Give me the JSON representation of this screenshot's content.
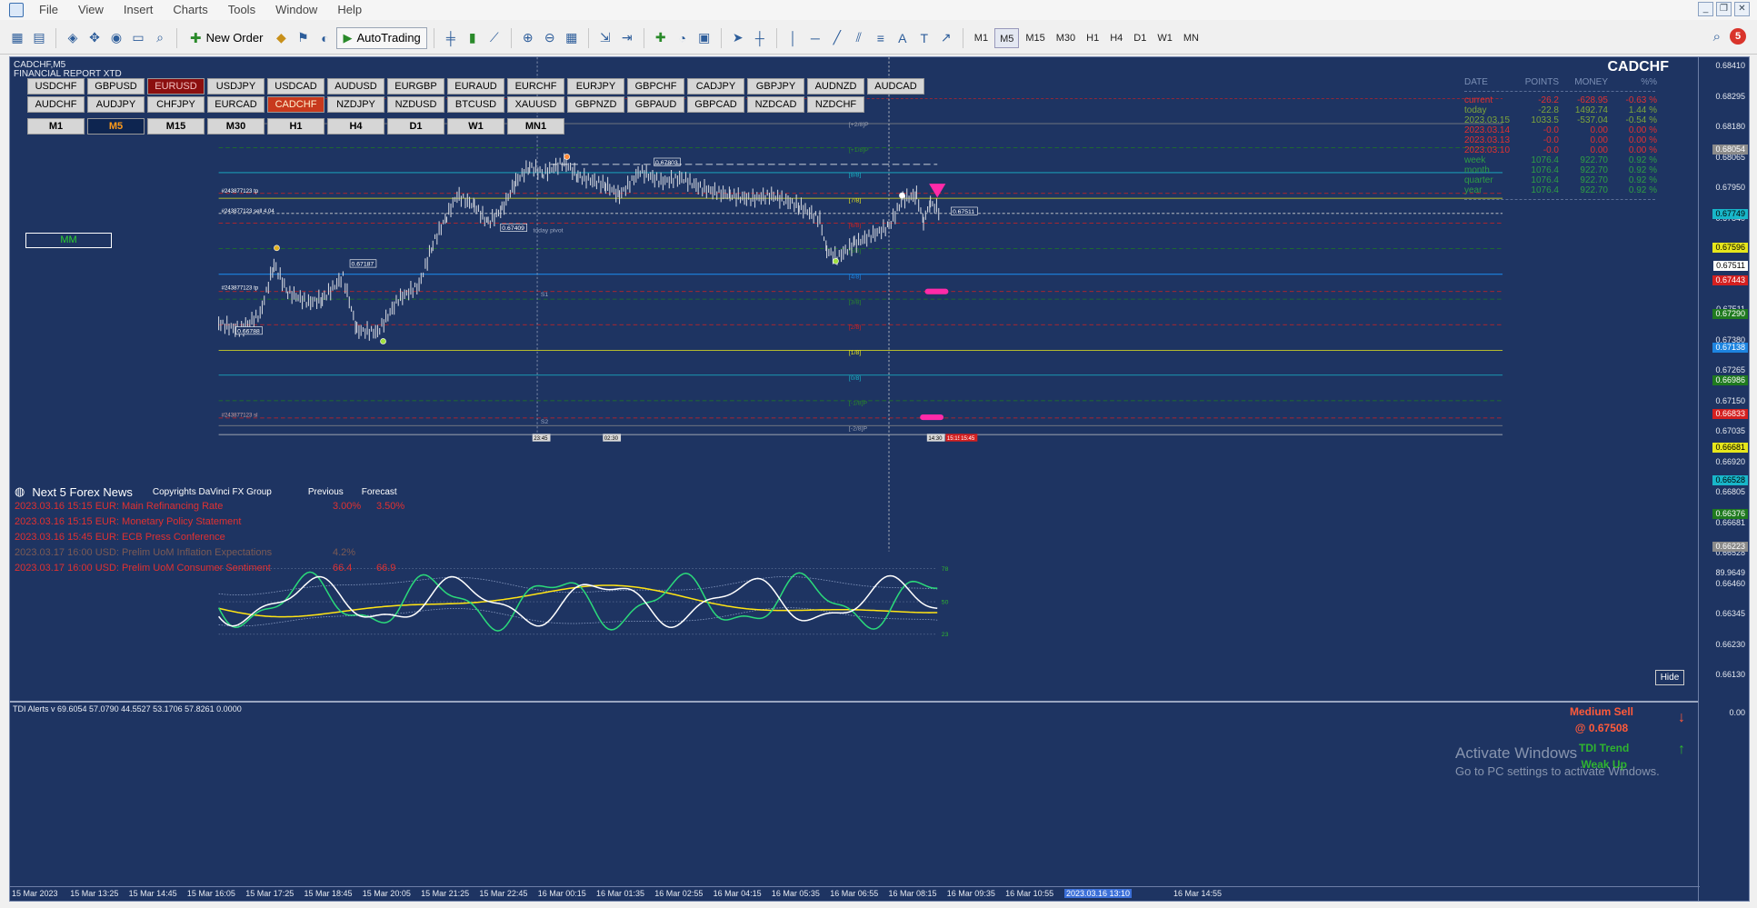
{
  "menu": [
    "File",
    "View",
    "Insert",
    "Charts",
    "Tools",
    "Window",
    "Help"
  ],
  "toolbar": {
    "new_order": "New Order",
    "autotrading": "AutoTrading",
    "timeframes": [
      "M1",
      "M5",
      "M15",
      "M30",
      "H1",
      "H4",
      "D1",
      "W1",
      "MN"
    ],
    "active_timeframe": "M5",
    "alert_count": "5"
  },
  "chart": {
    "title": "CADCHF,M5",
    "subtitle": "FINANCIAL REPORT XTD",
    "symbol_rows": [
      [
        "USDCHF",
        "GBPUSD",
        "EURUSD",
        "USDJPY",
        "USDCAD",
        "AUDUSD",
        "EURGBP",
        "EURAUD",
        "EURCHF",
        "EURJPY",
        "GBPCHF",
        "CADJPY",
        "GBPJPY",
        "AUDNZD",
        "AUDCAD"
      ],
      [
        "AUDCHF",
        "AUDJPY",
        "CHFJPY",
        "EURCAD",
        "CADCHF",
        "NZDJPY",
        "NZDUSD",
        "BTCUSD",
        "XAUUSD",
        "GBPNZD",
        "GBPAUD",
        "GBPCAD",
        "NZDCAD",
        "NZDCHF"
      ]
    ],
    "symbol_dark": "EURUSD",
    "symbol_active": "CADCHF",
    "chart_timeframes": [
      "M1",
      "M5",
      "M15",
      "M30",
      "H1",
      "H4",
      "D1",
      "W1",
      "MN1"
    ],
    "chart_tf_active": "M5",
    "murrey_labels": [
      "[+2/8]P",
      "[+1/8]P",
      "[8/8]",
      "[7/8]",
      "[6/8]",
      "[5/8]",
      "[4/8]",
      "[3/8]",
      "[2/8]",
      "[1/8]",
      "[0/8]",
      "[-1/8]P",
      "[-2/8]P"
    ],
    "pivot_labels": [
      "R1",
      "S1",
      "S2",
      "today pivot"
    ],
    "price_boxes": [
      "0.67803",
      "0.67409",
      "0.67187",
      "0.66788",
      "0.67511"
    ],
    "order_labels": [
      "#243877123 sell 4.04",
      "#243877123 tp",
      "#243877123 sl",
      "#243877123 tp"
    ],
    "mm_label": "MM"
  },
  "report": {
    "title": "CADCHF",
    "headers": [
      "DATE",
      "POINTS",
      "MONEY",
      "%%"
    ],
    "rows": [
      {
        "label": "current",
        "points": "-26.2",
        "money": "-628.95",
        "pct": "-0.63",
        "color": "#e03131"
      },
      {
        "label": "today",
        "points": "-22.8",
        "money": "1492.74",
        "pct": "1.44",
        "color": "#7ea63a"
      },
      {
        "label": "2023.03.15",
        "points": "1033.5",
        "money": "-537.04",
        "pct": "-0.54",
        "color": "#7ea63a"
      },
      {
        "label": "2023.03.14",
        "points": "-0.0",
        "money": "0.00",
        "pct": "0.00",
        "color": "#e03131"
      },
      {
        "label": "2023.03.13",
        "points": "-0.0",
        "money": "0.00",
        "pct": "0.00",
        "color": "#e03131"
      },
      {
        "label": "2023.03.10",
        "points": "-0.0",
        "money": "0.00",
        "pct": "0.00",
        "color": "#e03131"
      },
      {
        "label": "week",
        "points": "1076.4",
        "money": "922.70",
        "pct": "0.92",
        "color": "#2f9e44"
      },
      {
        "label": "month",
        "points": "1076.4",
        "money": "922.70",
        "pct": "0.92",
        "color": "#2f9e44"
      },
      {
        "label": "quarter",
        "points": "1076.4",
        "money": "922.70",
        "pct": "0.92",
        "color": "#2f9e44"
      },
      {
        "label": "year",
        "points": "1076.4",
        "money": "922.70",
        "pct": "0.92",
        "color": "#2f9e44"
      }
    ]
  },
  "news": {
    "title": "Next 5 Forex News",
    "copyright": "Copyrights DaVinci FX Group",
    "col_previous": "Previous",
    "col_forecast": "Forecast",
    "items": [
      {
        "text": "2023.03.16 15:15   EUR: Main Refinancing Rate",
        "previous": "3.00%",
        "forecast": "3.50%",
        "color": "#e03131"
      },
      {
        "text": "2023.03.16 15:15   EUR: Monetary Policy Statement",
        "previous": "",
        "forecast": "",
        "color": "#e03131"
      },
      {
        "text": "2023.03.16 15:45   EUR: ECB Press Conference",
        "previous": "",
        "forecast": "",
        "color": "#e03131"
      },
      {
        "text": "2023.03.17 16:00   USD: Prelim UoM Inflation Expectations",
        "previous": "4.2%",
        "forecast": "",
        "color": "#7b5a55"
      },
      {
        "text": "2023.03.17 16:00   USD: Prelim UoM Consumer Sentiment",
        "previous": "66.4",
        "forecast": "66.9",
        "color": "#e03131"
      }
    ],
    "hide_label": "Hide"
  },
  "price_axis": [
    "0.68410",
    "0.68295",
    "0.68180",
    "0.68065",
    "0.67950",
    "0.67840",
    "0.67725",
    "0.67596",
    "0.67511",
    "0.67380",
    "0.67265",
    "0.67150",
    "0.67035",
    "0.66920",
    "0.66805",
    "0.66681",
    "0.66528",
    "0.66460",
    "0.66345",
    "0.66230",
    "0.66130"
  ],
  "price_tags": [
    {
      "text": "0.68054",
      "bg": "#8a8a8a"
    },
    {
      "text": "0.67749",
      "bg": "#18b6c9"
    },
    {
      "text": "0.67596",
      "bg": "#e6e61c"
    },
    {
      "text": "0.67511",
      "bg": "#ffffff"
    },
    {
      "text": "0.67443",
      "bg": "#d42020"
    },
    {
      "text": "0.67290",
      "bg": "#1f7a1f"
    },
    {
      "text": "0.67138",
      "bg": "#1d84e0"
    },
    {
      "text": "0.66986",
      "bg": "#1f7a1f"
    },
    {
      "text": "0.66833",
      "bg": "#d42020"
    },
    {
      "text": "0.66681",
      "bg": "#e6e61c"
    },
    {
      "text": "0.66528",
      "bg": "#18b6c9"
    },
    {
      "text": "0.66376",
      "bg": "#1f7a1f"
    },
    {
      "text": "0.66223",
      "bg": "#8a8a8a"
    }
  ],
  "sub_axis": [
    "89.9649",
    "0.00"
  ],
  "sub_levels": [
    "78",
    "50",
    "23"
  ],
  "time_axis": [
    "15 Mar 2023",
    "15 Mar 13:25",
    "15 Mar 14:45",
    "15 Mar 16:05",
    "15 Mar 17:25",
    "15 Mar 18:45",
    "15 Mar 20:05",
    "15 Mar 21:25",
    "15 Mar 22:45",
    "16 Mar 00:15",
    "16 Mar 01:35",
    "16 Mar 02:55",
    "16 Mar 04:15",
    "16 Mar 05:35",
    "16 Mar 06:55",
    "16 Mar 08:15",
    "16 Mar 09:35",
    "16 Mar 10:55",
    "2023.03.16 13:10",
    "16 Mar 14:55"
  ],
  "time_markers": [
    "23:45",
    "02:30",
    "14:30",
    "15:15",
    "15:45"
  ],
  "tdi": {
    "label": "TDI Alerts v 69.6054 57.0790 44.5527 53.1706 57.8261 0.0000",
    "sell_signal": "Medium Sell",
    "sell_price": "@ 0.67508",
    "trend_title": "TDI Trend",
    "trend_value": "Weak Up"
  },
  "watermark": {
    "title": "Activate Windows",
    "sub": "Go to PC settings to activate Windows."
  }
}
